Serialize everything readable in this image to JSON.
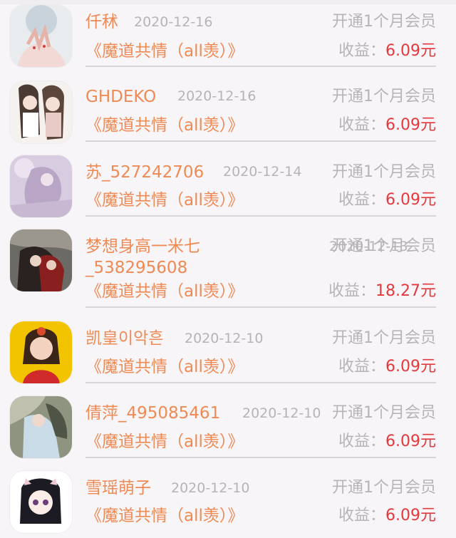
{
  "income_label": "收益：",
  "records": [
    {
      "name": "仟秫",
      "date": "2020-12-16",
      "action": "开通1个月会员",
      "book": "《魔道共情（all羡）》",
      "income": "6.09元"
    },
    {
      "name": "GHDEKO",
      "date": "2020-12-16",
      "action": "开通1个月会员",
      "book": "《魔道共情（all羡）》",
      "income": "6.09元"
    },
    {
      "name": "苏_527242706",
      "date": "2020-12-14",
      "action": "开通1个月会员",
      "book": "《魔道共情（all羡）》",
      "income": "6.09元"
    },
    {
      "name": "梦想身高一米七",
      "name2": "_538295608",
      "date": "2020-12-13",
      "action": "开通1个月会员",
      "book": "《魔道共情（all羡）》",
      "income": "18.27元"
    },
    {
      "name": "凯皇이악흔",
      "date": "2020-12-10",
      "action": "开通1个月会员",
      "book": "《魔道共情（all羡）》",
      "income": "6.09元"
    },
    {
      "name": "倩萍_495085461",
      "date": "2020-12-10",
      "action": "开通1个月会员",
      "book": "《魔道共情（all羡）》",
      "income": "6.09元"
    },
    {
      "name": "雪瑶萌子",
      "date": "2020-12-10",
      "action": "开通1个月会员",
      "book": "《魔道共情（all羡）》",
      "income": "6.09元"
    }
  ]
}
